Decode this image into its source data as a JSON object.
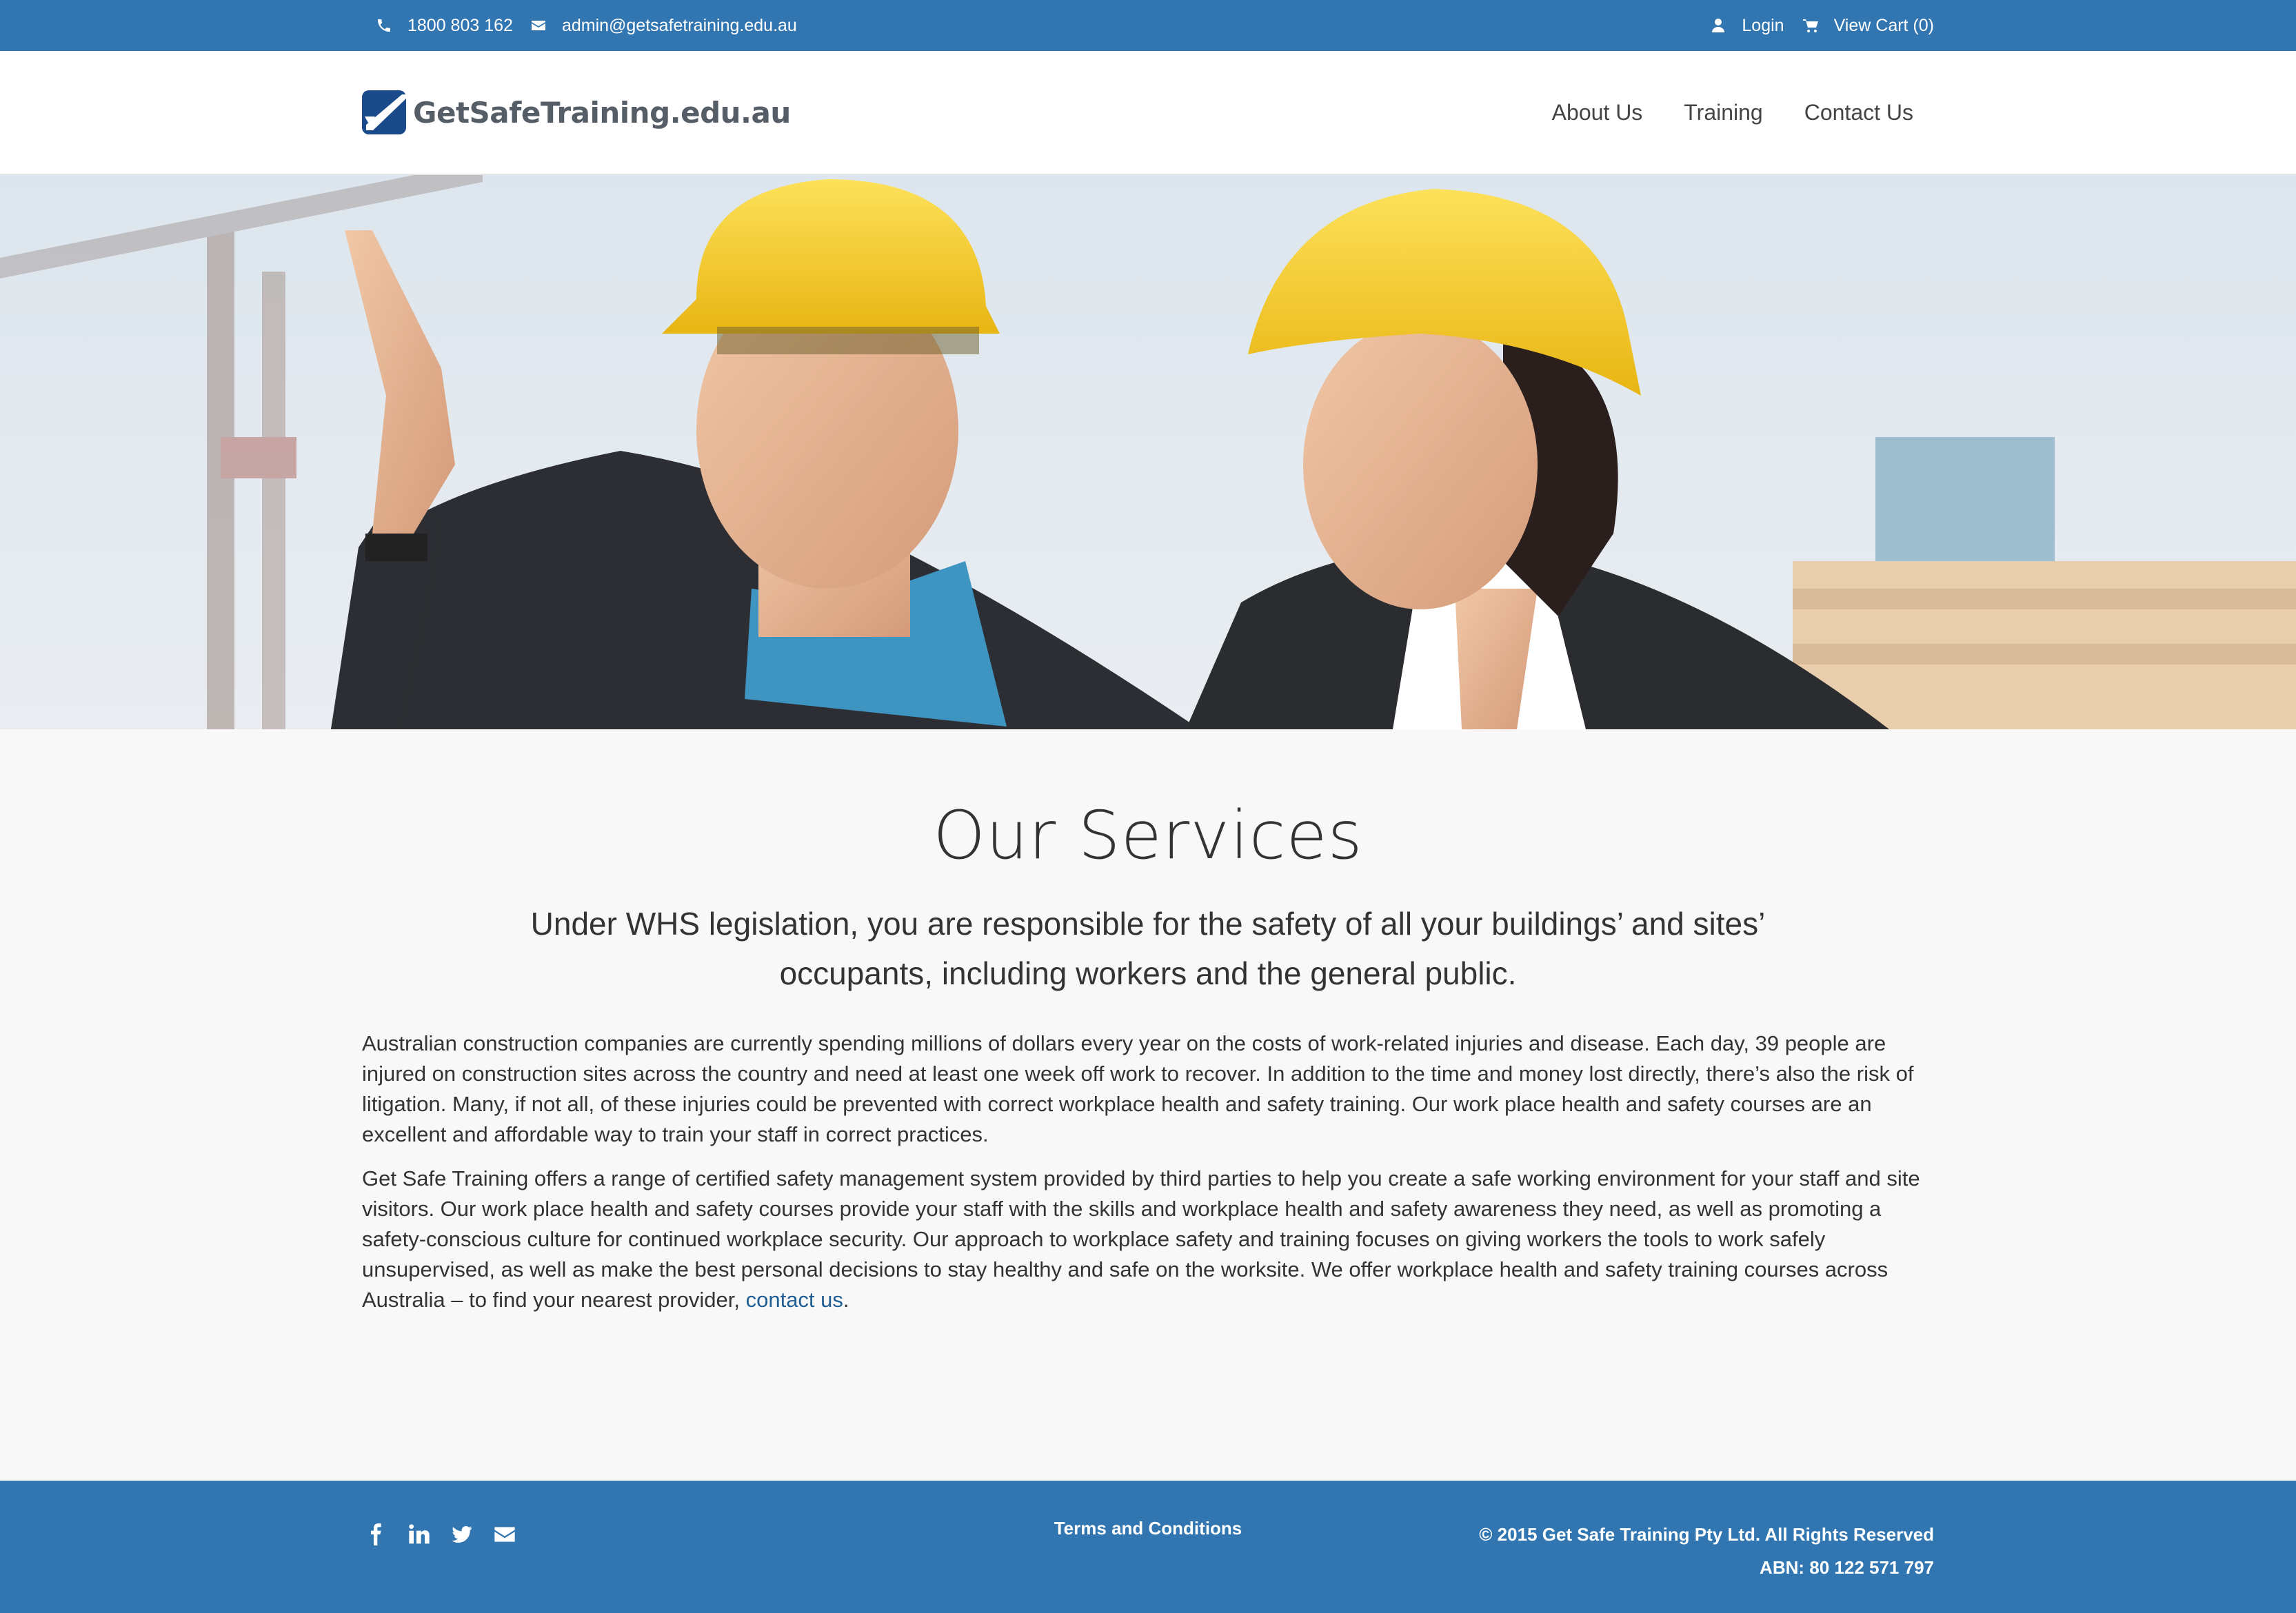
{
  "topbar": {
    "phone": "1800 803 162",
    "email": "admin@getsafetraining.edu.au",
    "login": "Login",
    "cart": "View Cart (0)"
  },
  "header": {
    "logo_text": "GetSafeTraining.edu.au",
    "nav": [
      "About Us",
      "Training",
      "Contact Us"
    ]
  },
  "main": {
    "title": "Our Services",
    "lead": "Under WHS legislation, you are responsible for the safety of all your buildings’ and sites’ occupants, including workers and the general public.",
    "paragraph1": "Australian construction companies are currently spending millions of dollars every year on the costs of work-related injuries and disease. Each day, 39 people are injured on construction sites across the country and need at least one week off work to recover. In addition to the time and money lost directly, there’s also the risk of litigation. Many, if not all, of these injuries could be prevented with correct workplace health and safety training. Our work place health and safety courses are an excellent and affordable way to train your staff in correct practices.",
    "paragraph2": "Get Safe Training offers a range of certified safety management system provided by third parties to help you create a safe working environment for your staff and site visitors. Our work place health and safety courses provide your staff with the skills and workplace health and safety awareness they need, as well as promoting a safety-conscious culture for continued workplace security. Our approach to workplace safety and training focuses on giving workers the tools to work safely unsupervised, as well as make the best personal decisions to stay healthy and safe on the worksite. We offer workplace health and safety training courses across Australia – to find your nearest provider,",
    "contact_link": "contact us",
    "paragraph2_end": "."
  },
  "footer": {
    "social_icons": [
      "facebook-icon",
      "linkedin-icon",
      "twitter-icon",
      "envelope-icon"
    ],
    "terms": "Terms and Conditions",
    "copyright": "© 2015 Get Safe Training Pty Ltd. All Rights Reserved",
    "abn": "ABN: 80 122 571 797"
  },
  "colors": {
    "brand_blue": "#3175b1",
    "logo_blue": "#1a4a8a",
    "link_blue": "#1f5d93",
    "helmet_yellow": "#f5c820"
  }
}
